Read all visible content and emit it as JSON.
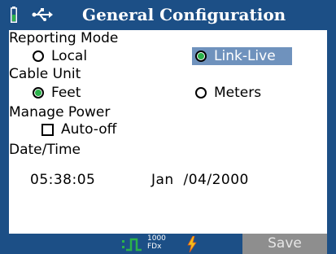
{
  "header": {
    "title": "General Configuration",
    "battery_icon": "battery-icon",
    "usb_icon": "usb-icon"
  },
  "reporting_mode": {
    "label": "Reporting Mode",
    "options": [
      {
        "label": "Local",
        "selected": false
      },
      {
        "label": "Link-Live",
        "selected": true
      }
    ]
  },
  "cable_unit": {
    "label": "Cable Unit",
    "options": [
      {
        "label": "Feet",
        "selected": true
      },
      {
        "label": "Meters",
        "selected": false
      }
    ]
  },
  "manage_power": {
    "label": "Manage Power",
    "auto_off_label": "Auto-off",
    "auto_off_checked": false
  },
  "date_time": {
    "label": "Date/Time",
    "time": "05:38:05",
    "date": "Jan  /04/2000"
  },
  "status_bar": {
    "link_icon": "link-pulse-icon",
    "speed_top": "1000",
    "speed_bottom": "FDx",
    "power_icon": "lightning-icon"
  },
  "softkeys": {
    "save_label": "Save"
  },
  "colors": {
    "bar_blue": "#1c4f86",
    "highlight": "#6f92bd",
    "radio_green": "#2bb24a",
    "softkey_gray": "#8e8e8e",
    "bolt_yellow": "#f2c01a"
  }
}
